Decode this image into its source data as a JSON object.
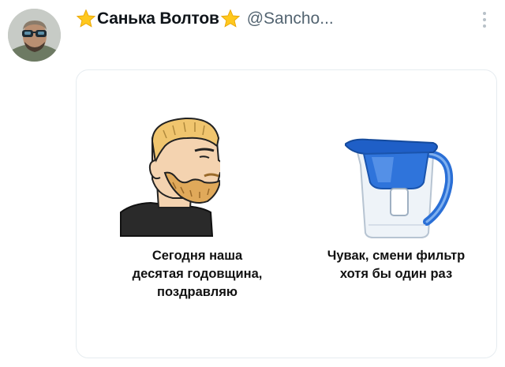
{
  "tweet": {
    "author_name": "Санька Волтов",
    "handle": "@Sancho...",
    "avatar": "avatar-photo",
    "more_icon": "more-vertical-icon"
  },
  "meme": {
    "left_caption": [
      "Сегодня наша",
      "десятая годовщина,",
      "поздравляю"
    ],
    "right_caption": [
      "Чувак, смени фильтр",
      "хотя бы один раз"
    ]
  },
  "colors": {
    "star": "#ffc81e",
    "name": "#0f1419",
    "handle": "#536471",
    "pitcher_blue": "#1f5fc7"
  }
}
